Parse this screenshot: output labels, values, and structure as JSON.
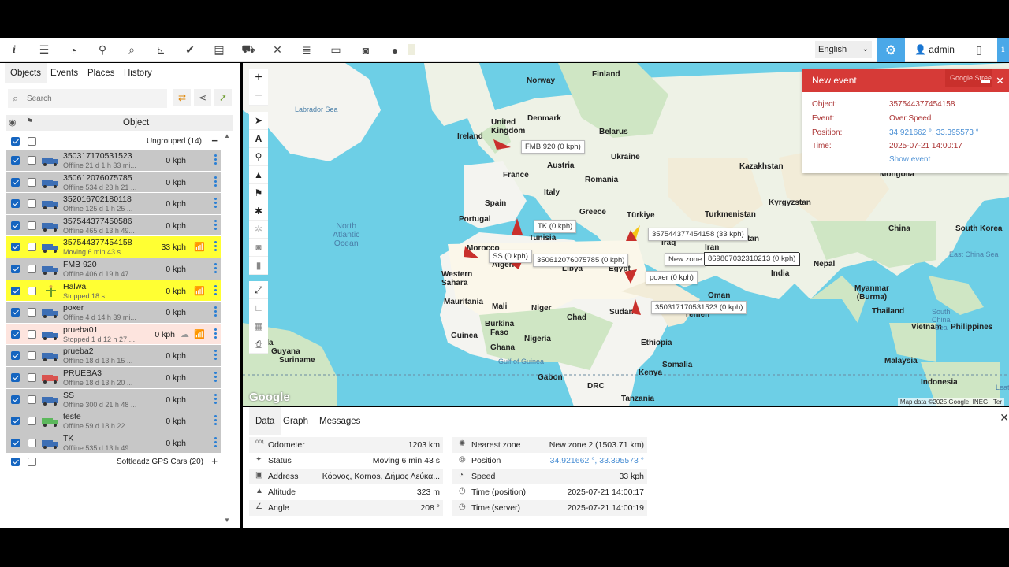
{
  "toolbar": {
    "icons": [
      "info-icon",
      "sliders-icon",
      "dashboard-icon",
      "location-pin-icon",
      "search-icon",
      "chart-icon",
      "check-icon",
      "book-icon",
      "car-icon",
      "tools-icon",
      "database-icon",
      "code-icon",
      "camera-icon",
      "chat-icon"
    ],
    "language": "English",
    "user": "admin"
  },
  "sidebar": {
    "tabs": [
      "Objects",
      "Events",
      "Places",
      "History"
    ],
    "search_placeholder": "Search",
    "column_header": "Object",
    "group1": {
      "label": "Ungrouped (14)",
      "toggle": "−"
    },
    "group2": {
      "label": "Softleadz GPS Cars (20)",
      "toggle": "+"
    },
    "objects": [
      {
        "name": "350317170531523",
        "status": "Offline 21 d 1 h 33 mi...",
        "speed": "0 kph",
        "style": "gray",
        "vehicle": "truck"
      },
      {
        "name": "350612076075785",
        "status": "Offline 534 d 23 h 21 ...",
        "speed": "0 kph",
        "style": "gray",
        "vehicle": "truck"
      },
      {
        "name": "352016702180118",
        "status": "Offline 125 d 1 h 25 ...",
        "speed": "0 kph",
        "style": "gray",
        "vehicle": "truck"
      },
      {
        "name": "357544377450586",
        "status": "Offline 465 d 13 h 49...",
        "speed": "0 kph",
        "style": "gray",
        "vehicle": "truck"
      },
      {
        "name": "357544377454158",
        "status": "Moving 6 min 43 s",
        "speed": "33 kph",
        "style": "yellow",
        "vehicle": "truck",
        "wifi": true
      },
      {
        "name": "FMB 920",
        "status": "Offline 406 d 19 h 47 ...",
        "speed": "0 kph",
        "style": "gray",
        "vehicle": "truck"
      },
      {
        "name": "Halwa",
        "status": "Stopped 18 s",
        "speed": "0 kph",
        "style": "yellow",
        "vehicle": "person",
        "wifi": true
      },
      {
        "name": "poxer",
        "status": "Offline 4 d 14 h 39 mi...",
        "speed": "0 kph",
        "style": "gray",
        "vehicle": "truck"
      },
      {
        "name": "prueba01",
        "status": "Stopped 1 d 12 h 27 ...",
        "speed": "0 kph",
        "style": "pink",
        "vehicle": "truck",
        "wifi": true,
        "cloud": true
      },
      {
        "name": "prueba2",
        "status": "Offline 18 d 13 h 15 ...",
        "speed": "0 kph",
        "style": "gray",
        "vehicle": "truck"
      },
      {
        "name": "PRUEBA3",
        "status": "Offline 18 d 13 h 20 ...",
        "speed": "0 kph",
        "style": "gray",
        "vehicle": "car"
      },
      {
        "name": "SS",
        "status": "Offline 300 d 21 h 48 ...",
        "speed": "0 kph",
        "style": "gray",
        "vehicle": "truck"
      },
      {
        "name": "teste",
        "status": "Offline 59 d 18 h 22 ...",
        "speed": "0 kph",
        "style": "gray",
        "vehicle": "car-green"
      },
      {
        "name": "TK",
        "status": "Offline 535 d 13 h 49 ...",
        "speed": "0 kph",
        "style": "gray",
        "vehicle": "truck"
      }
    ]
  },
  "map": {
    "labels": {
      "norway": "Norway",
      "finland": "Finland",
      "labrador": "Labrador Sea",
      "uk": "United Kingdom",
      "denmark": "Denmark",
      "ireland": "Ireland",
      "belarus": "Belarus",
      "austria": "Austria",
      "ukraine": "Ukraine",
      "france": "France",
      "kazakhstan": "Kazakhstan",
      "mongolia": "Mongolia",
      "romania": "Romania",
      "italy": "Italy",
      "spain": "Spain",
      "kyrgyzstan": "Kyrgyzstan",
      "greece": "Greece",
      "turkiye": "Türkiye",
      "turkmenistan": "Turkmenistan",
      "portugal": "Portugal",
      "natl": "North\nAtlantic\nOcean",
      "china": "China",
      "skorea": "South Korea",
      "tunisia": "Tunisia",
      "afghanistan": "anistan",
      "morocco": "Morocco",
      "ecsea": "East China Sea",
      "algeria": "Algeria",
      "libya": "Libya",
      "egypt": "Egypt",
      "iraq": "Iraq",
      "iran": "Iran",
      "nepal": "Nepal",
      "wsahara": "Western\nSahara",
      "myanmar": "Myanmar\n(Burma)",
      "mauritania": "Mauritania",
      "mali": "Mali",
      "niger": "Niger",
      "oman": "Oman",
      "thailand": "Thailand",
      "sudan": "Sudan",
      "chad": "Chad",
      "burkina": "Burkina\nFaso",
      "yemen": "Yemen",
      "vietnam": "Vietnam",
      "philippines": "Philippines",
      "guinea": "Guinea",
      "nigeria": "Nigeria",
      "ghana": "Ghana",
      "ethiopia": "Ethiopia",
      "scsea": "South\nChina\nSea",
      "guyana": "Guyana",
      "suriname": "Suriname",
      "venezuela": "ezuela",
      "gulfguinea": "Gulf of Guinea",
      "somalia": "Somalia",
      "malaysia": "Malaysia",
      "kenya": "Kenya",
      "gabon": "Gabon",
      "drc": "DRC",
      "indonesia": "Indonesia",
      "tanzania": "Tanzania",
      "arabian": "abian",
      "india": "India",
      "leat": "Leat"
    },
    "markers": {
      "fmb920": "FMB 920 (0 kph)",
      "tk": "TK (0 kph)",
      "ss": "SS (0 kph)",
      "m357": "357544377454158 (33 kph)",
      "m350612": "350612076075785 (0 kph)",
      "newzone": "New zone",
      "m869": "869867032310213 (0 kph)",
      "poxer": "poxer (0 kph)",
      "m350317": "350317170531523 (0 kph)"
    },
    "attribution": "Map data ©2025 Google, INEGI",
    "attribution_tail": "Ter",
    "google": "Google",
    "tools": [
      "zoom-in-icon",
      "zoom-out-icon",
      "navigate-icon",
      "text-icon",
      "pin-icon",
      "road-icon",
      "flag-icon",
      "asterisk-icon",
      "sun-icon",
      "camera-icon",
      "barrel-icon",
      "fullscreen-icon",
      "ruler-icon",
      "area-icon",
      "print-icon"
    ]
  },
  "event_popup": {
    "title": "New event",
    "overlay": "Google Street",
    "rows": [
      {
        "k": "Object:",
        "v": "357544377454158"
      },
      {
        "k": "Event:",
        "v": "Over Speed"
      },
      {
        "k": "Position:",
        "v": "34.921662 °, 33.395573 °"
      },
      {
        "k": "Time:",
        "v": "2025-07-21 14:00:17"
      }
    ],
    "link": "Show event"
  },
  "bottom": {
    "tabs": [
      "Data",
      "Graph",
      "Messages"
    ],
    "left": [
      {
        "k": "Odometer",
        "v": "1203 km"
      },
      {
        "k": "Status",
        "v": "Moving 6 min 43 s"
      },
      {
        "k": "Address",
        "v": "Κόρνος, Kornos, Δήμος Λεύκα..."
      },
      {
        "k": "Altitude",
        "v": "323 m"
      },
      {
        "k": "Angle",
        "v": "208 °"
      }
    ],
    "right": [
      {
        "k": "Nearest zone",
        "v": "New zone 2 (1503.71 km)"
      },
      {
        "k": "Position",
        "v": "34.921662 °, 33.395573 °"
      },
      {
        "k": "Speed",
        "v": "33 kph"
      },
      {
        "k": "Time (position)",
        "v": "2025-07-21 14:00:17"
      },
      {
        "k": "Time (server)",
        "v": "2025-07-21 14:00:19"
      }
    ]
  }
}
